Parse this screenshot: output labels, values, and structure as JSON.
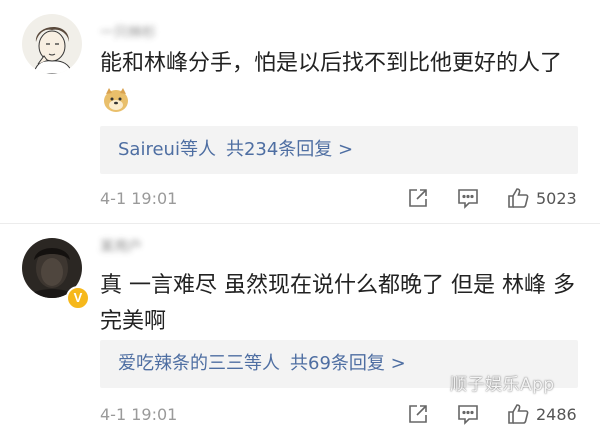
{
  "comments": [
    {
      "username": "一只林杉",
      "text": "能和林峰分手，怕是以后找不到比他更好的人了",
      "emoji": "doge-emoji",
      "reply_names": "Saireui",
      "reply_suffix": "等人",
      "reply_count": "共234条回复 >",
      "time": "4-1 19:01",
      "likes": "5023"
    },
    {
      "username": "某用户",
      "verified": "V",
      "text": "真 一言难尽 虽然现在说什么都晚了 但是 林峰 多完美啊",
      "reply_names": "爱吃辣条的三三",
      "reply_suffix": "等人",
      "reply_count": "共69条回复 >",
      "time": "4-1 19:01",
      "likes": "2486"
    }
  ],
  "watermark": "顺子娱乐App",
  "colors": {
    "link": "#4e6ea2",
    "reply_bg": "#f3f3f3",
    "meta": "#9a9a9a",
    "verified": "#f6b81b"
  },
  "icons": [
    "share-icon",
    "comment-icon",
    "like-icon"
  ]
}
